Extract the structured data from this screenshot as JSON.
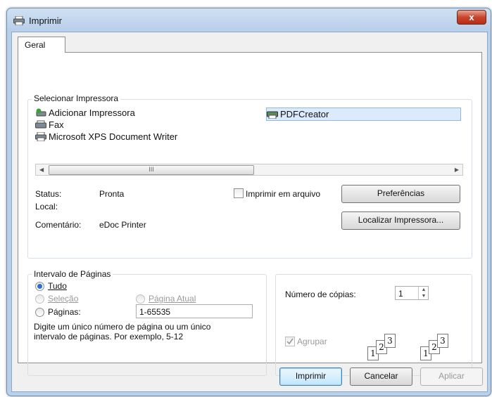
{
  "window": {
    "title": "Imprimir",
    "close_glyph": "x"
  },
  "tabs": [
    {
      "label": "Geral"
    }
  ],
  "select_printer": {
    "label": "Selecionar Impressora",
    "printers": [
      {
        "name": "Adicionar Impressora",
        "icon": "add-printer-icon"
      },
      {
        "name": "Fax",
        "icon": "fax-printer-icon"
      },
      {
        "name": "Microsoft XPS Document Writer",
        "icon": "printer-icon"
      },
      {
        "name": "PDFCreator",
        "icon": "printer-icon",
        "selected": true
      }
    ],
    "scroll_thumb_glyph": "III",
    "status_label": "Status:",
    "status_value": "Pronta",
    "location_label": "Local:",
    "location_value": "",
    "comment_label": "Comentário:",
    "comment_value": "eDoc Printer",
    "print_to_file_label": "Imprimir em arquivo",
    "preferences_button": "Preferências",
    "find_printer_button": "Localizar Impressora..."
  },
  "page_range": {
    "label": "Intervalo de Páginas",
    "all_label": "Tudo",
    "selection_label": "Seleção",
    "current_page_label": "Página Atual",
    "pages_label": "Páginas:",
    "pages_value": "1-65535",
    "hint": "Digite um único número de página ou um único intervalo de páginas. Por exemplo, 5-12",
    "selected": "all"
  },
  "copies": {
    "label": "Número de cópias:",
    "value": "1",
    "collate_label": "Agrupar",
    "collate_checked": true,
    "collate_enabled": false,
    "illustration_numbers": [
      "1",
      "2",
      "3"
    ]
  },
  "buttons": {
    "print": "Imprimir",
    "cancel": "Cancelar",
    "apply": "Aplicar"
  }
}
